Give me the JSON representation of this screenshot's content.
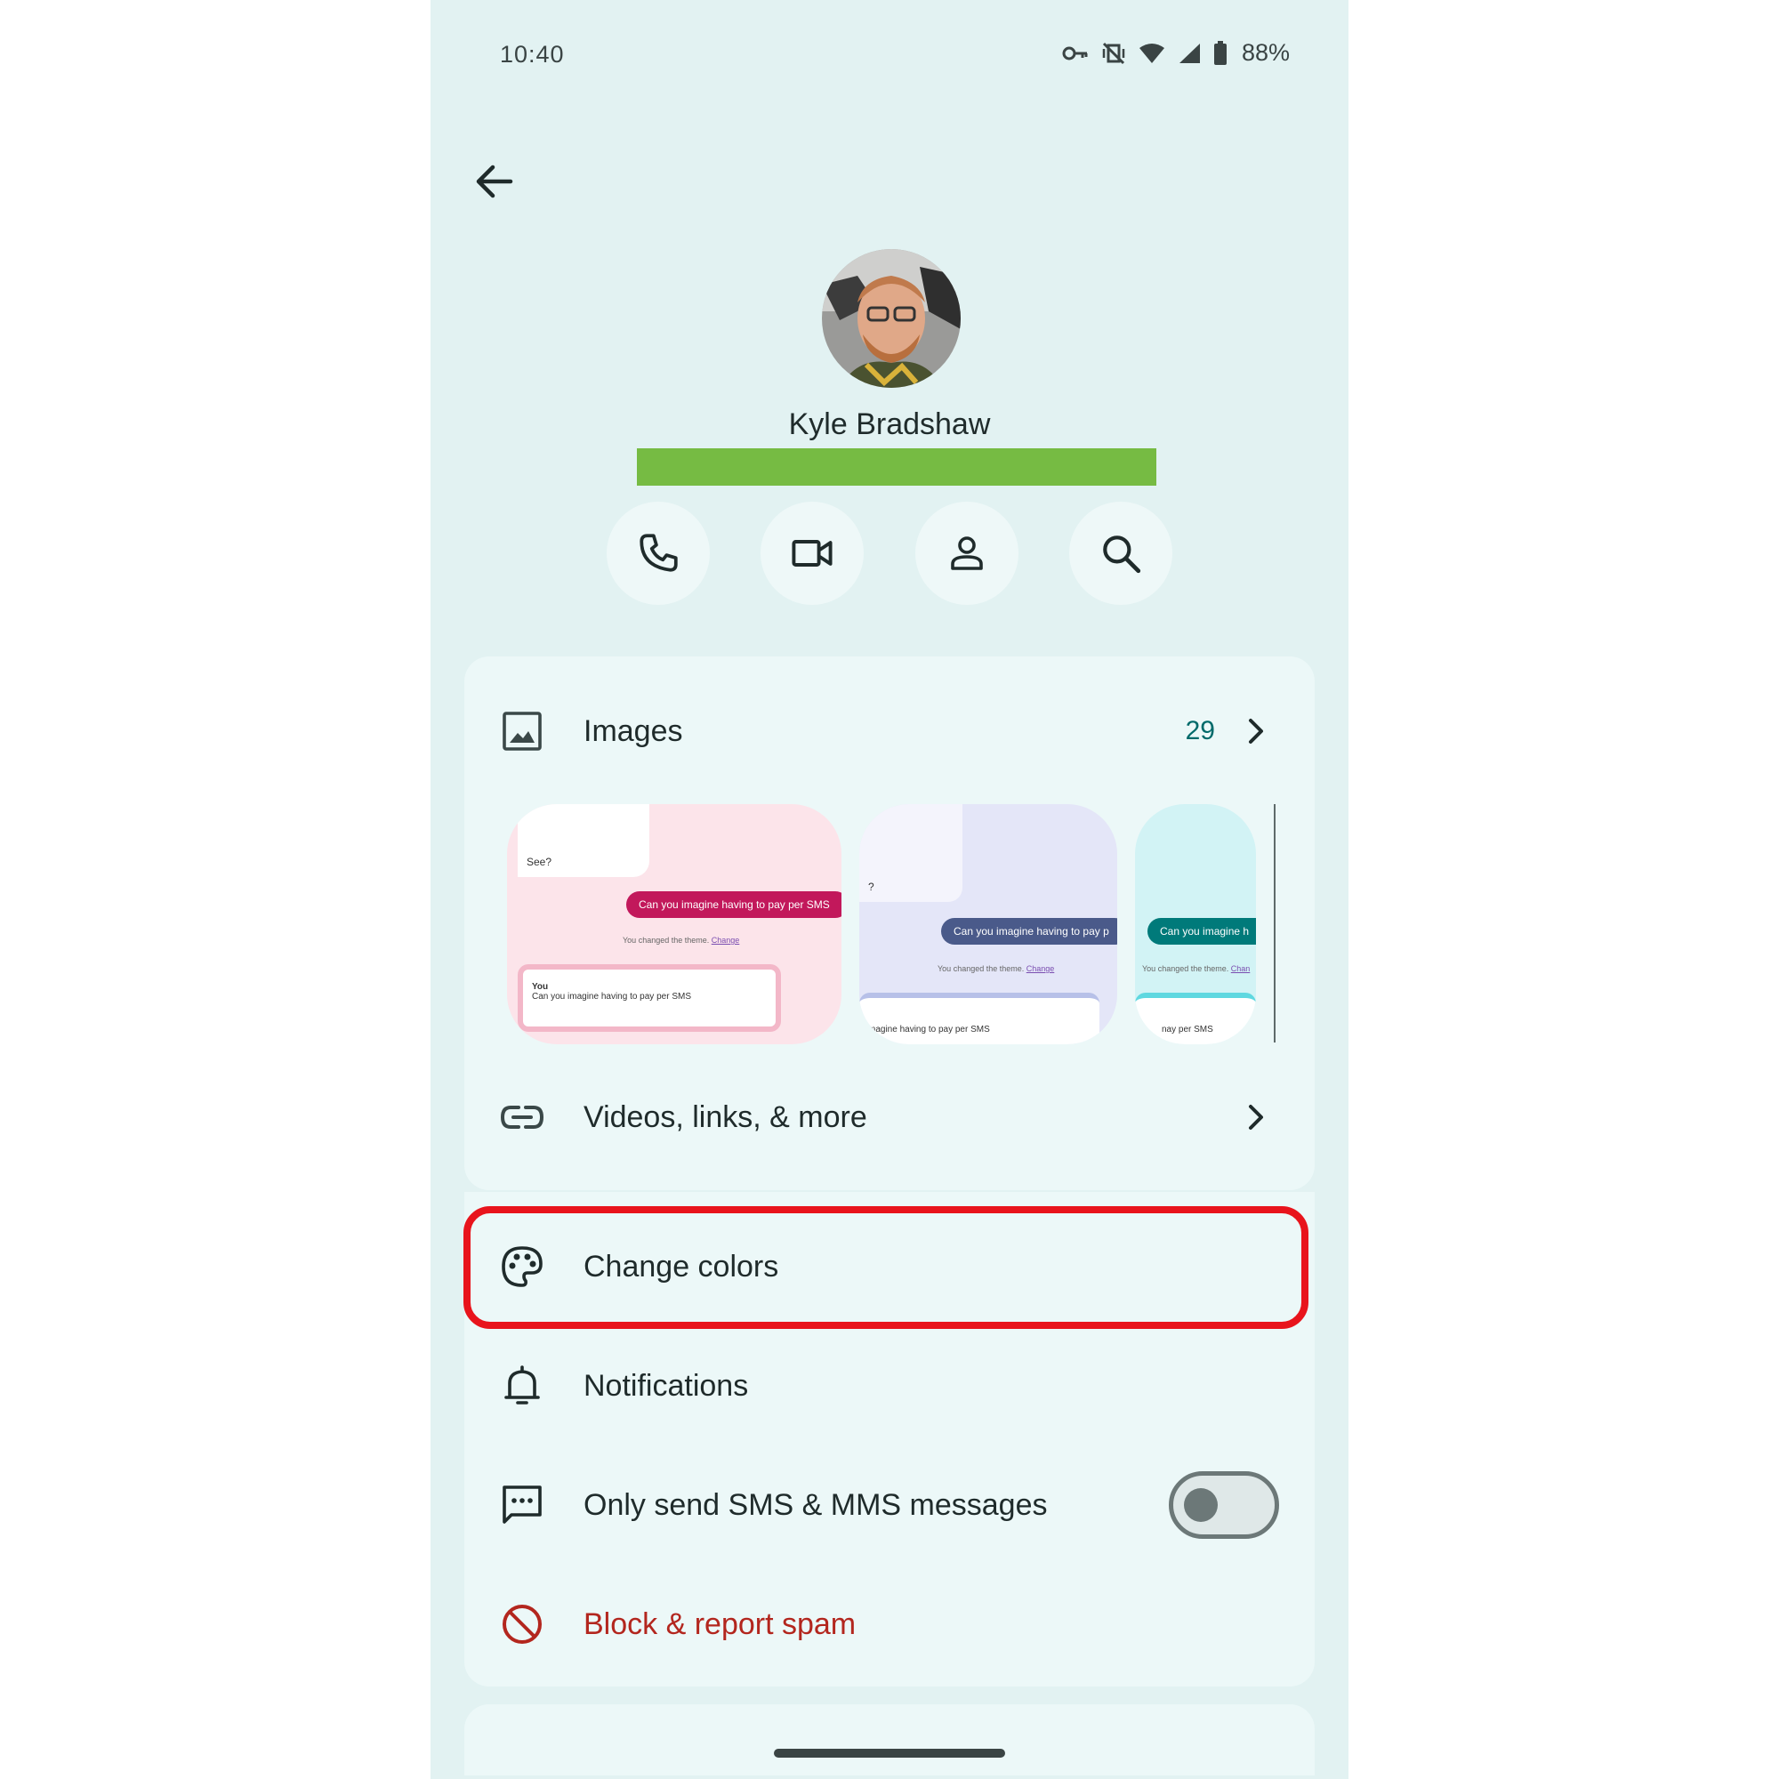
{
  "status_bar": {
    "time": "10:40",
    "battery": "88%",
    "icons": [
      "vpn-key-icon",
      "vibrate-off-icon",
      "wifi-icon",
      "cell-signal-icon",
      "battery-icon"
    ]
  },
  "header": {
    "back_icon": "arrow-back-icon",
    "contact_name": "Kyle Bradshaw",
    "redaction_color": "#76bb43"
  },
  "actions": [
    {
      "icon": "phone-icon"
    },
    {
      "icon": "video-call-icon"
    },
    {
      "icon": "contact-icon"
    },
    {
      "icon": "search-icon"
    }
  ],
  "media": {
    "images": {
      "label": "Images",
      "count": "29",
      "icon": "image-icon"
    },
    "thumbnails": [
      {
        "incoming": "See?",
        "outgoing": "Can you imagine having to pay per SMS",
        "note": "You changed the theme.",
        "note_link": "Change",
        "compose_sender": "You",
        "compose_text": "Can you imagine having to pay per SMS",
        "accent": "#c2185b"
      },
      {
        "incoming": "?",
        "outgoing": "Can you imagine having to pay p",
        "note": "You changed the theme.",
        "note_link": "Change",
        "compose_text": "magine having to pay per SMS",
        "accent": "#4a5a8a"
      },
      {
        "outgoing": "Can you imagine h",
        "note": "You changed the theme.",
        "note_link": "Chan",
        "compose_text": "nay per SMS",
        "accent": "#007a7a"
      }
    ],
    "videos": {
      "label": "Videos, links, & more",
      "icon": "link-icon"
    }
  },
  "settings": {
    "change_colors": {
      "label": "Change colors",
      "icon": "palette-icon"
    },
    "notifications": {
      "label": "Notifications",
      "icon": "bell-icon"
    },
    "sms_only": {
      "label": "Only send SMS & MMS messages",
      "icon": "message-dots-icon",
      "enabled": false
    },
    "block": {
      "label": "Block & report spam",
      "icon": "block-icon"
    }
  },
  "colors": {
    "background": "#e2f2f2",
    "card": "#ecf8f8",
    "accent_count": "#006a6a",
    "danger": "#b3261e",
    "highlight": "#e8141c"
  }
}
